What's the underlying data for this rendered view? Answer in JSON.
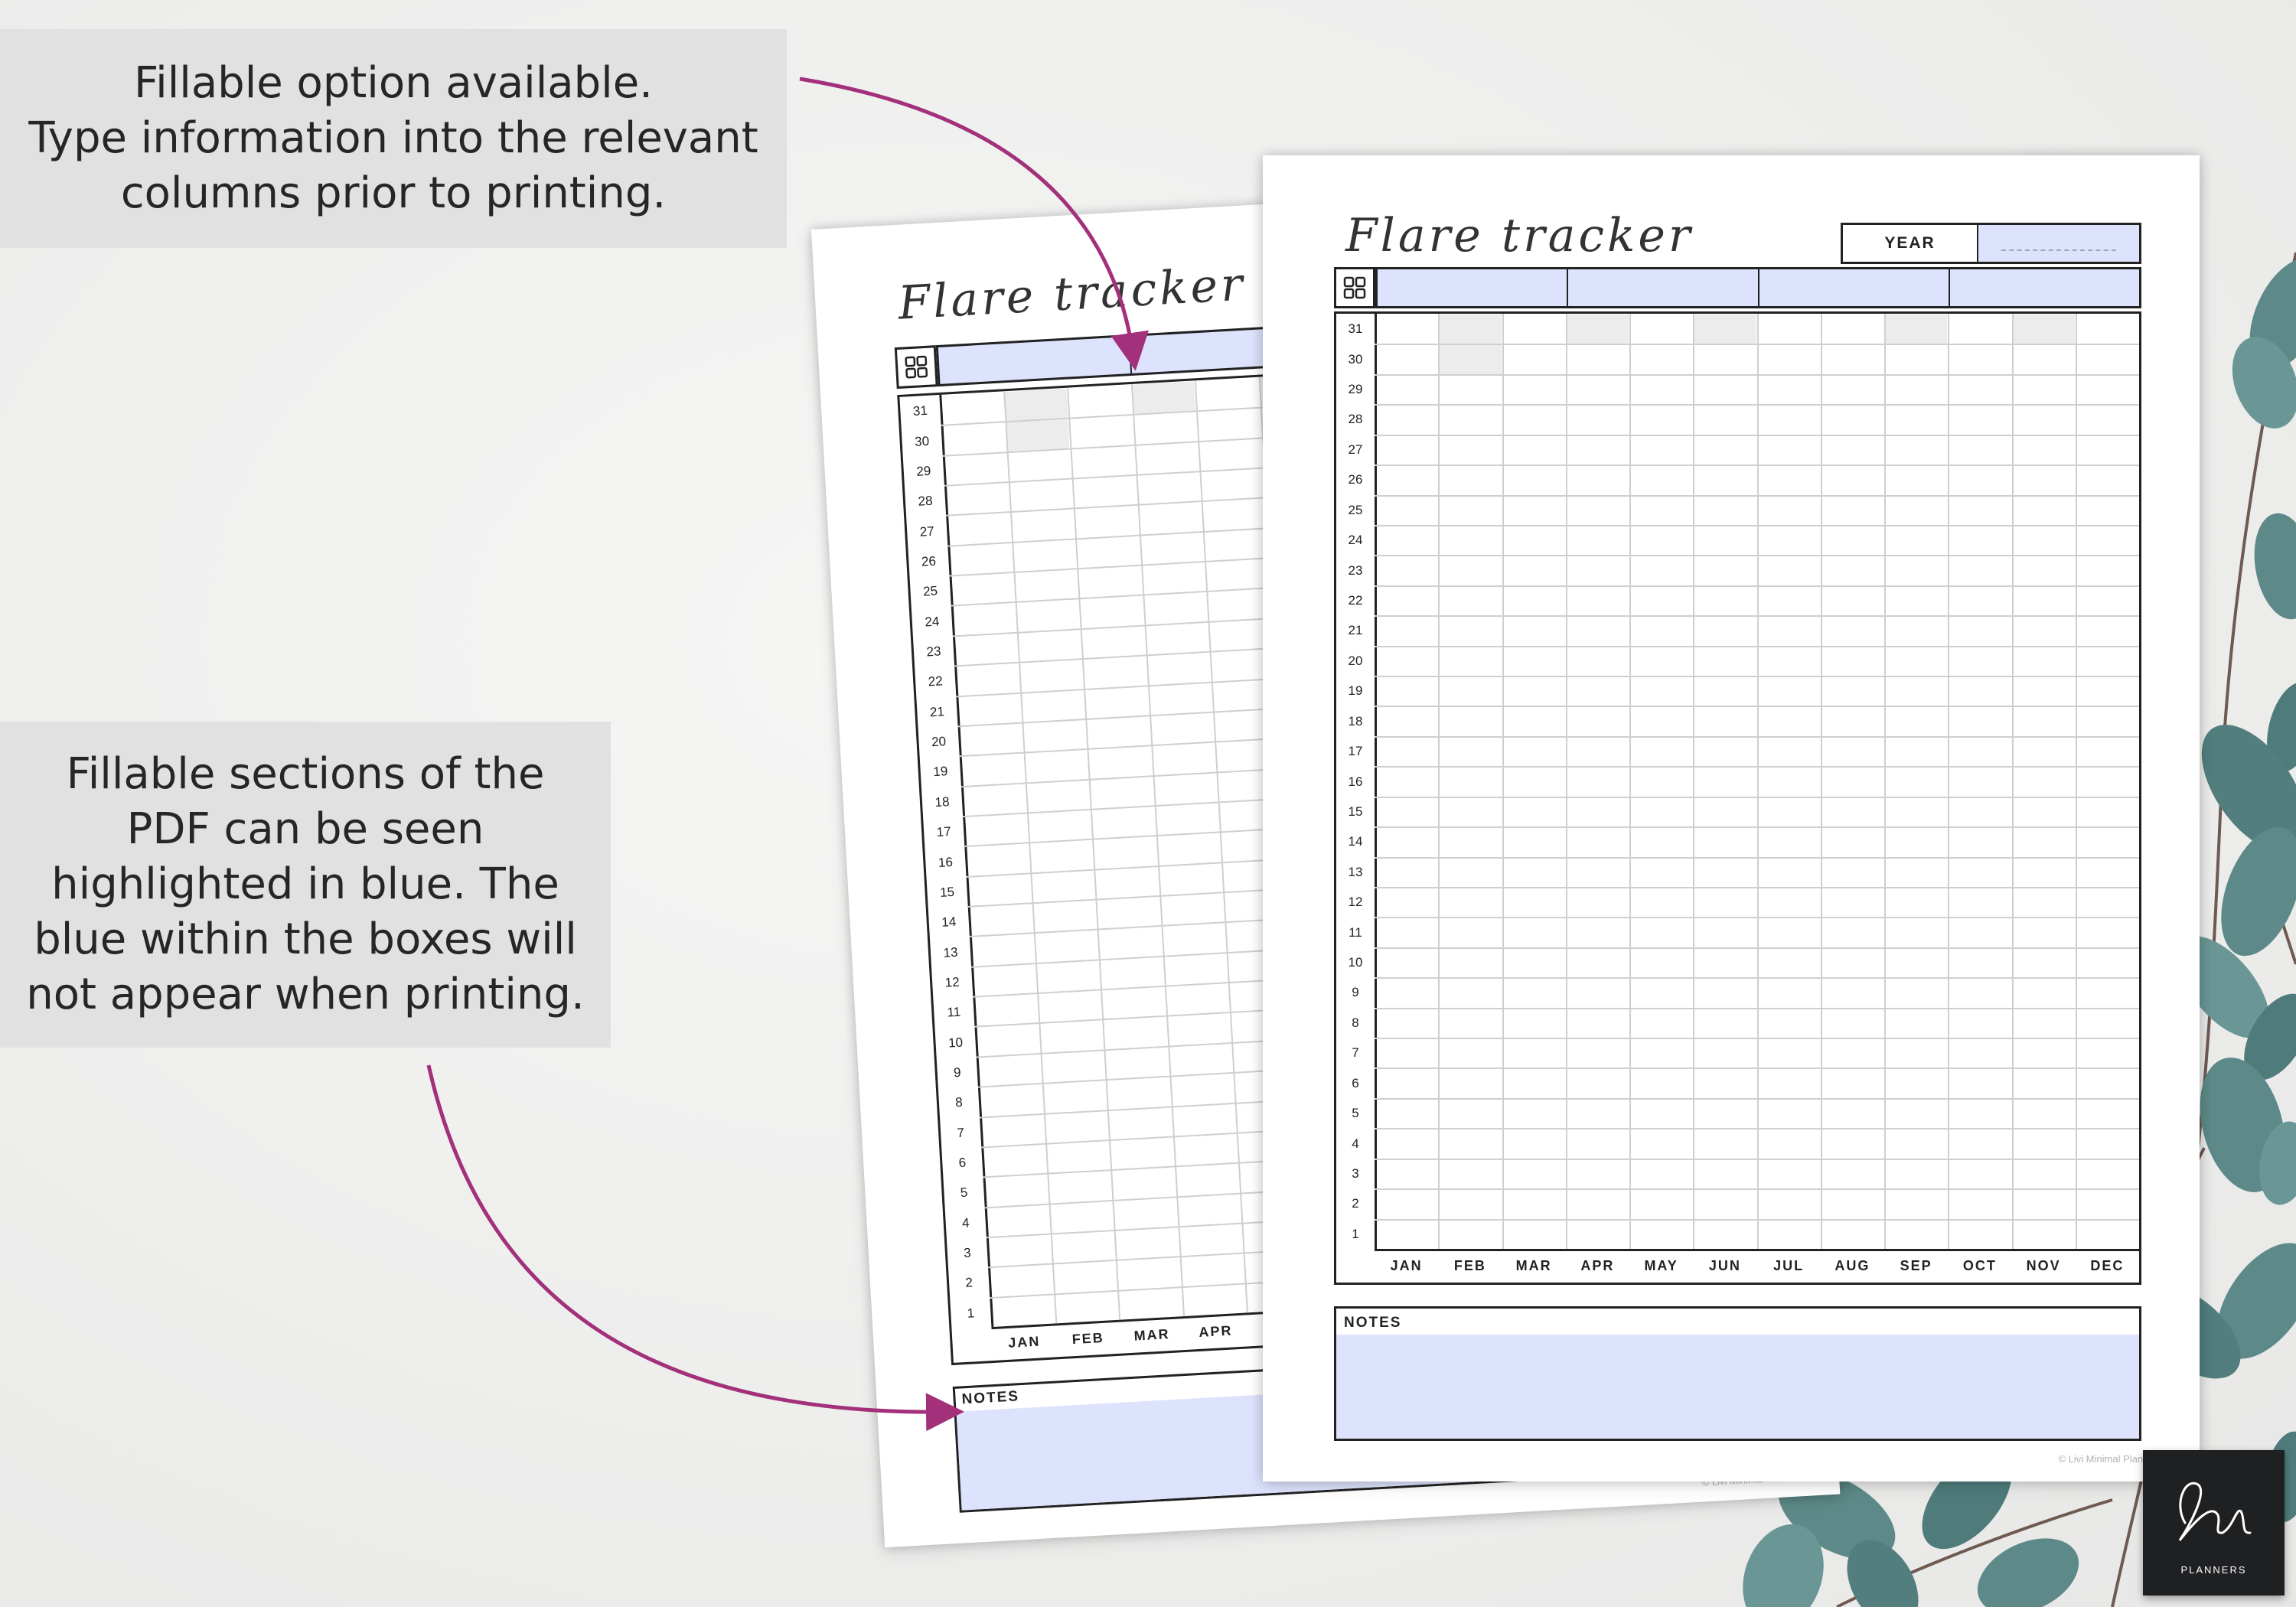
{
  "callouts": {
    "top": [
      "Fillable option available.",
      "Type information into the relevant",
      "columns prior to printing."
    ],
    "bottom": [
      "Fillable sections of the",
      "PDF can be seen",
      "highlighted in blue. The",
      "blue within the boxes will",
      "not appear when printing."
    ]
  },
  "planner": {
    "title": "Flare tracker",
    "year_label": "YEAR",
    "notes_label": "NOTES",
    "copyright": "© Livi Minimal Planners.",
    "months": [
      "JAN",
      "FEB",
      "MAR",
      "APR",
      "MAY",
      "JUN",
      "JUL",
      "AUG",
      "SEP",
      "OCT",
      "NOV",
      "DEC"
    ],
    "days": [
      "31",
      "30",
      "29",
      "28",
      "27",
      "26",
      "25",
      "24",
      "23",
      "22",
      "21",
      "20",
      "19",
      "18",
      "17",
      "16",
      "15",
      "14",
      "13",
      "12",
      "11",
      "10",
      "9",
      "8",
      "7",
      "6",
      "5",
      "4",
      "3",
      "2",
      "1"
    ],
    "category_icon": "grid-2x2-icon"
  },
  "colors": {
    "fillable_blue": "#dde3fd",
    "arrow": "#a3307b",
    "unused_day_gray": "#ececec"
  },
  "logo": {
    "text": "PLANNERS"
  }
}
